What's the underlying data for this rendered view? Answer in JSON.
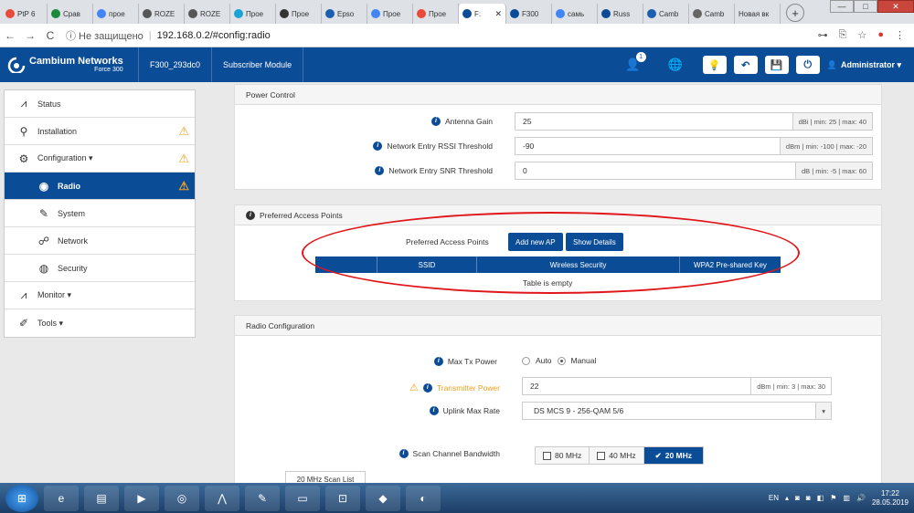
{
  "browser": {
    "tabs": [
      {
        "label": "PtP 6",
        "color": "#e84b3a"
      },
      {
        "label": "Срав",
        "color": "#1a8a3a"
      },
      {
        "label": "прое",
        "color": "#4285f4"
      },
      {
        "label": "ROZE",
        "color": "#555555"
      },
      {
        "label": "ROZE",
        "color": "#555555"
      },
      {
        "label": "Прое",
        "color": "#1ba3d6"
      },
      {
        "label": "Прое",
        "color": "#333333"
      },
      {
        "label": "Epso",
        "color": "#1b5fae"
      },
      {
        "label": "Прое",
        "color": "#4285f4"
      },
      {
        "label": "Прое",
        "color": "#e84b3a"
      },
      {
        "label": "F:",
        "color": "#0b4c97",
        "active": true
      },
      {
        "label": "F300",
        "color": "#0b4c97"
      },
      {
        "label": "cамь",
        "color": "#4285f4"
      },
      {
        "label": "Russ",
        "color": "#0b4c97"
      },
      {
        "label": "Camb",
        "color": "#1b5fae"
      },
      {
        "label": "Camb",
        "color": "#666666"
      },
      {
        "label": "Новая вк",
        "color": ""
      }
    ],
    "close_tab": "✕",
    "new_tab": "+",
    "back": "←",
    "forward": "→",
    "reload": "C",
    "insecure": "ⓘ Не защищено",
    "url": "192.168.0.2/#config:radio",
    "addr_icons": [
      "⊶",
      "⎘",
      "☆",
      "●",
      "⋮"
    ]
  },
  "header": {
    "brand": "Cambium Networks",
    "model": "Force 300",
    "device": "F300_293dc0",
    "mode": "Subscriber Module",
    "badge": "1",
    "admin": "Administrator ▾"
  },
  "sidebar": {
    "items": [
      {
        "label": "Status",
        "icon": "⩘"
      },
      {
        "label": "Installation",
        "icon": "⚲",
        "warn": "⚠"
      },
      {
        "label": "Configuration ▾",
        "icon": "⚙",
        "warn": "⚠"
      },
      {
        "label": "Radio",
        "icon": "◉",
        "warn": "⚠",
        "active": true
      },
      {
        "label": "System",
        "icon": "✎"
      },
      {
        "label": "Network",
        "icon": "☍"
      },
      {
        "label": "Security",
        "icon": "◍"
      },
      {
        "label": "Monitor ▾",
        "icon": "⩘"
      },
      {
        "label": "Tools ▾",
        "icon": "✐"
      }
    ]
  },
  "power": {
    "title": "Power Control",
    "rows": [
      {
        "label": "Antenna Gain",
        "value": "25",
        "addon": "dBi | min: 25 | max: 40"
      },
      {
        "label": "Network Entry RSSI Threshold",
        "value": "-90",
        "addon": "dBm | min: -100 | max: -20"
      },
      {
        "label": "Network Entry SNR Threshold",
        "value": "0",
        "addon": "dB | min: -5 | max: 60"
      }
    ]
  },
  "pap": {
    "title": "Preferred Access Points",
    "row_label": "Preferred Access Points",
    "add_btn": "Add new AP",
    "details_btn": "Show Details",
    "columns": [
      "",
      "SSID",
      "Wireless Security",
      "WPA2 Pre-shared Key"
    ],
    "empty": "Table is empty"
  },
  "radio": {
    "title": "Radio Configuration",
    "max_tx_label": "Max Tx Power",
    "auto": "Auto",
    "manual": "Manual",
    "tx_power_label": "Transmitter Power",
    "tx_power_value": "22",
    "tx_power_addon": "dBm | min: 3 | max: 30",
    "uplink_label": "Uplink Max Rate",
    "uplink_value": "DS MCS 9 - 256-QAM 5/6",
    "scan_label": "Scan Channel Bandwidth",
    "bw_80": "80 MHz",
    "bw_40": "40 MHz",
    "bw_20": "20 MHz",
    "scan_list_btn": "20 MHz Scan List"
  },
  "taskbar": {
    "lang": "EN",
    "time": "17:22",
    "date": "28.05.2019"
  },
  "colors": {
    "brand_blue": "#0b4c97",
    "warning": "#f0a020",
    "annotation_red": "#e0161b"
  }
}
